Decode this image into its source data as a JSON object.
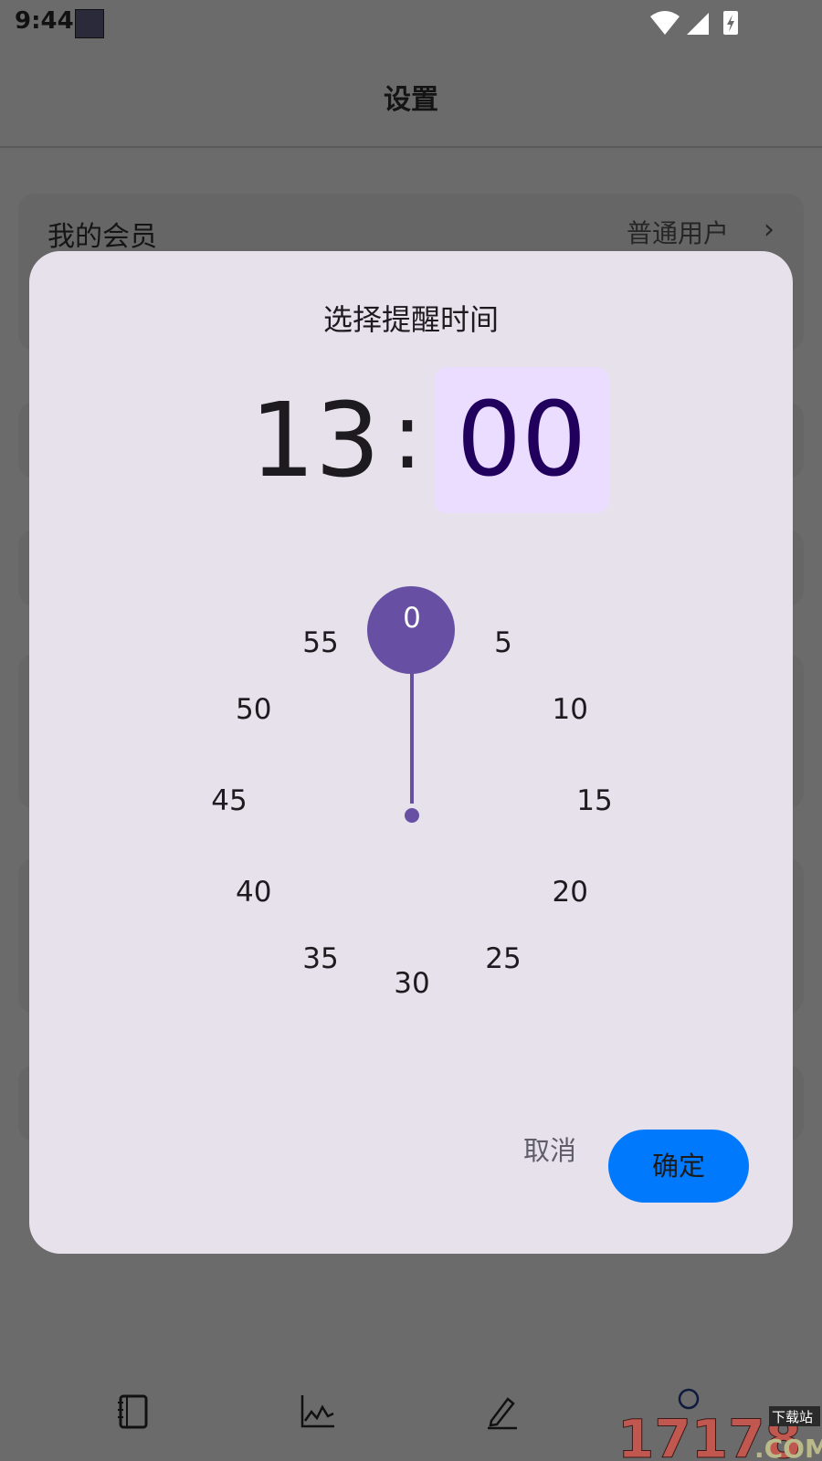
{
  "status_bar": {
    "time": "9:44"
  },
  "header": {
    "title": "设置"
  },
  "settings": {
    "membership": {
      "label": "我的会员",
      "value": "普通用户",
      "chevron": "›"
    }
  },
  "dialog": {
    "title": "选择提醒时间",
    "hour": "13",
    "separator": ":",
    "minute": "00",
    "dial_labels": [
      "0",
      "5",
      "10",
      "15",
      "20",
      "25",
      "30",
      "35",
      "40",
      "45",
      "50",
      "55"
    ],
    "selected_minute": 0,
    "accent_color": "#6750a4",
    "cancel_label": "取消",
    "ok_label": "确定",
    "ok_color": "#0079fc"
  },
  "bottom_nav": {
    "icons": [
      "notebook-icon",
      "chart-line-icon",
      "pen-icon",
      "profile-icon"
    ]
  },
  "watermark": {
    "text": "17178",
    "suffix": ".COM",
    "tag": "下载站"
  }
}
